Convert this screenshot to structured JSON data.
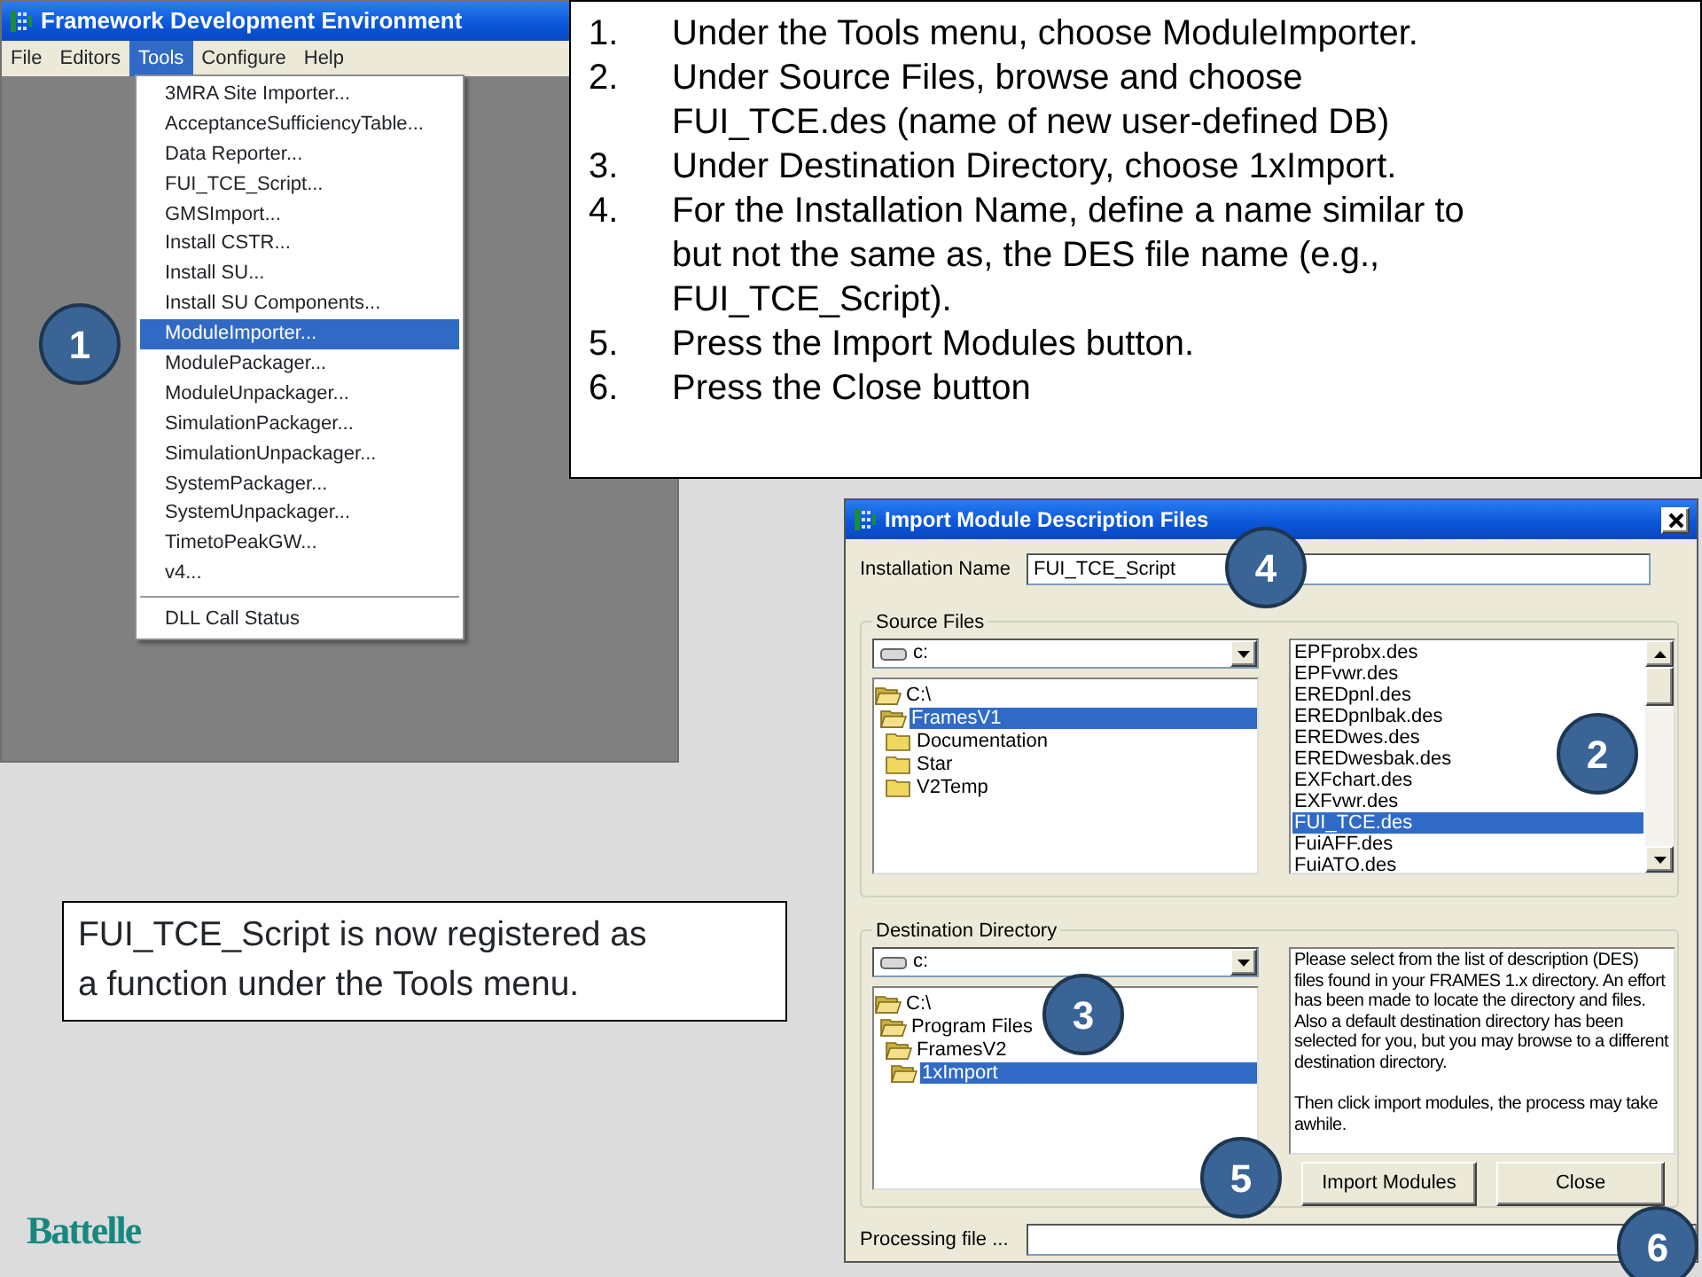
{
  "app_window": {
    "title": "Framework Development Environment",
    "menu": [
      {
        "label": "File",
        "selected": false
      },
      {
        "label": "Editors",
        "selected": false
      },
      {
        "label": "Tools",
        "selected": true
      },
      {
        "label": "Configure",
        "selected": false
      },
      {
        "label": "Help",
        "selected": false
      }
    ],
    "tools_menu": {
      "items": [
        {
          "label": "3MRA Site Importer...",
          "selected": false
        },
        {
          "label": "AcceptanceSufficiencyTable...",
          "selected": false
        },
        {
          "label": "Data Reporter...",
          "selected": false
        },
        {
          "label": "FUI_TCE_Script...",
          "selected": false
        },
        {
          "label": "GMSImport...",
          "selected": false
        },
        {
          "label": "Install CSTR...",
          "selected": false
        },
        {
          "label": "Install SU...",
          "selected": false
        },
        {
          "label": "Install SU Components...",
          "selected": false
        },
        {
          "label": "ModuleImporter...",
          "selected": true
        },
        {
          "label": "ModulePackager...",
          "selected": false
        },
        {
          "label": "ModuleUnpackager...",
          "selected": false
        },
        {
          "label": "SimulationPackager...",
          "selected": false
        },
        {
          "label": "SimulationUnpackager...",
          "selected": false
        },
        {
          "label": "SystemPackager...",
          "selected": false
        },
        {
          "label": "SystemUnpackager...",
          "selected": false
        },
        {
          "label": "TimetoPeakGW...",
          "selected": false
        },
        {
          "label": "v4...",
          "selected": false
        }
      ],
      "extra_items": [
        {
          "label": "DLL Call Status",
          "selected": false
        }
      ]
    }
  },
  "instructions": [
    {
      "number": "1.",
      "text": "Under the Tools menu, choose ModuleImporter."
    },
    {
      "number": "2.",
      "text": "Under Source Files, browse and choose FUI_TCE.des (name of new user-defined DB)"
    },
    {
      "number": "3.",
      "text": "Under Destination Directory, choose 1xImport."
    },
    {
      "number": "4.",
      "text": "For the Installation Name, define a name similar to but not the same as, the DES file name (e.g., FUI_TCE_Script)."
    },
    {
      "number": "5.",
      "text": "Press the Import Modules button."
    },
    {
      "number": "6.",
      "text": "Press the Close button"
    }
  ],
  "dialog": {
    "title": "Import Module Description Files",
    "installation_name": {
      "label": "Installation Name",
      "value": "FUI_TCE_Script"
    },
    "source_files": {
      "legend": "Source Files",
      "drive": "c:",
      "folders": [
        {
          "name": "C:\\",
          "selected": false,
          "expanded": true,
          "children": [
            {
              "name": "FramesV1",
              "selected": true,
              "expanded": true,
              "children": [
                {
                  "name": "Documentation",
                  "selected": false,
                  "expanded": false
                },
                {
                  "name": "Star",
                  "selected": false,
                  "expanded": false
                },
                {
                  "name": "V2Temp",
                  "selected": false,
                  "expanded": false
                }
              ]
            }
          ]
        }
      ],
      "files": [
        {
          "name": "EPFprobx.des",
          "selected": false
        },
        {
          "name": "EPFvwr.des",
          "selected": false
        },
        {
          "name": "EREDpnl.des",
          "selected": false
        },
        {
          "name": "EREDpnlbak.des",
          "selected": false
        },
        {
          "name": "EREDwes.des",
          "selected": false
        },
        {
          "name": "EREDwesbak.des",
          "selected": false
        },
        {
          "name": "EXFchart.des",
          "selected": false
        },
        {
          "name": "EXFvwr.des",
          "selected": false
        },
        {
          "name": "FUI_TCE.des",
          "selected": true
        },
        {
          "name": "FuiAFF.des",
          "selected": false
        },
        {
          "name": "FuiATO.des",
          "selected": false
        }
      ]
    },
    "destination_directory": {
      "legend": "Destination Directory",
      "drive": "c:",
      "folders": [
        {
          "name": "C:\\",
          "selected": false,
          "expanded": true,
          "children": [
            {
              "name": "Program Files",
              "selected": false,
              "expanded": true,
              "children": [
                {
                  "name": "FramesV2",
                  "selected": false,
                  "expanded": true,
                  "children": [
                    {
                      "name": "1xImport",
                      "selected": true,
                      "expanded": true
                    }
                  ]
                }
              ]
            }
          ]
        }
      ],
      "help_text": [
        "Please select from the list of description (DES) files found in your FRAMES 1.x directory. An effort has been made to locate the directory and files. Also a default destination directory has been selected for you, but you may browse to a different destination directory.",
        "Then click import modules, the process may take awhile."
      ]
    },
    "buttons": [
      {
        "label": "Import Modules"
      },
      {
        "label": "Close"
      }
    ],
    "processing": {
      "label": "Processing file ..."
    }
  },
  "note": "FUI_TCE_Script is now registered as a function under the Tools menu.",
  "logo": "Battelle",
  "callouts": [
    "1",
    "4",
    "2",
    "3",
    "5",
    "6"
  ]
}
